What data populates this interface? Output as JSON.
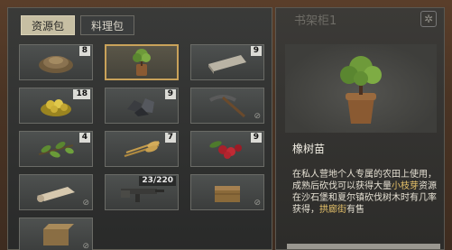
{
  "tabs": [
    {
      "label": "资源包",
      "active": true
    },
    {
      "label": "料理包",
      "active": false
    }
  ],
  "slots": [
    {
      "icon": "soil-pile-icon",
      "count": "8"
    },
    {
      "icon": "tree-sapling-icon",
      "count": "",
      "selected": true
    },
    {
      "icon": "cloth-roll-icon",
      "count": "9"
    },
    {
      "icon": "gold-ore-icon",
      "count": "18"
    },
    {
      "icon": "coal-ore-icon",
      "count": "9"
    },
    {
      "icon": "pickaxe-icon",
      "count": ""
    },
    {
      "icon": "leaf-branch-icon",
      "count": "4"
    },
    {
      "icon": "wheat-icon",
      "count": "7"
    },
    {
      "icon": "berries-icon",
      "count": "9"
    },
    {
      "icon": "fabric-roll-icon",
      "count": ""
    },
    {
      "icon": "rifle-icon",
      "count": "23/220"
    },
    {
      "icon": "wooden-crate-icon",
      "count": ""
    },
    {
      "icon": "wooden-box-icon",
      "count": ""
    }
  ],
  "detail": {
    "title": "书架柜1",
    "item_name": "橡树苗",
    "desc_1": "在私人营地个人专属的农田上使用，成熟后砍伐可以获得大量",
    "desc_hl_1": "小枝芽",
    "desc_2": "资源",
    "desc_3": "在沙石堡和夏尔镇砍伐树木时有几率获得，",
    "desc_hl_2": "拱廊街",
    "desc_4": "有售"
  },
  "colors": {
    "highlight": "#e6c26a",
    "selected_border": "#c9a25a",
    "active_tab": "#c7bfa3"
  }
}
